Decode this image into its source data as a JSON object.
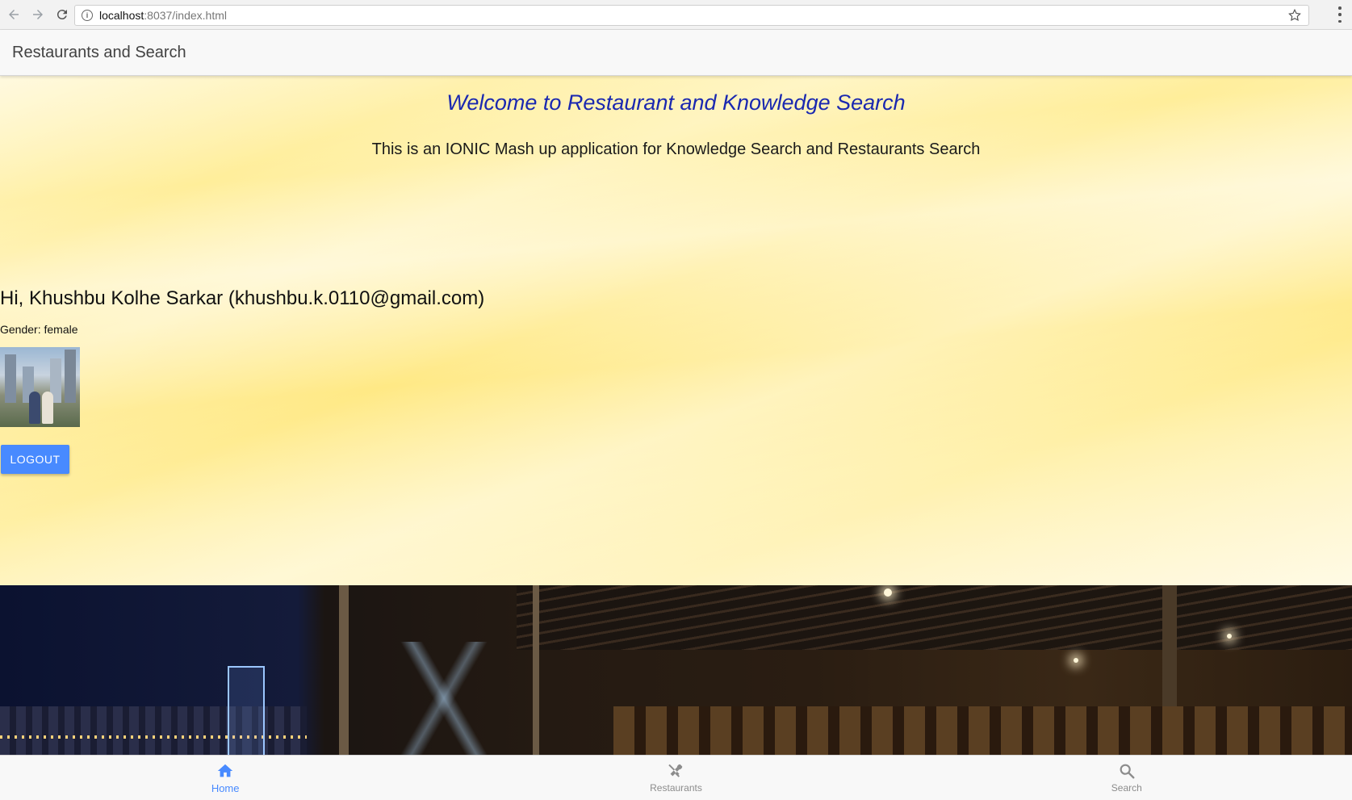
{
  "browser": {
    "url_host": "localhost",
    "url_path": ":8037/index.html"
  },
  "header": {
    "title": "Restaurants and Search"
  },
  "content": {
    "welcome": "Welcome to Restaurant and Knowledge Search",
    "tagline": "This is an IONIC Mash up application for Knowledge Search and Restaurants Search",
    "greeting": "Hi, Khushbu Kolhe Sarkar (khushbu.k.0110@gmail.com)",
    "gender": "Gender: female",
    "logout_label": "LOGOUT"
  },
  "tabs": [
    {
      "label": "Home",
      "icon": "home-icon",
      "active": true
    },
    {
      "label": "Restaurants",
      "icon": "restaurant-icon",
      "active": false
    },
    {
      "label": "Search",
      "icon": "search-icon",
      "active": false
    }
  ],
  "colors": {
    "accent": "#488aff",
    "welcome_text": "#1a28b0"
  }
}
